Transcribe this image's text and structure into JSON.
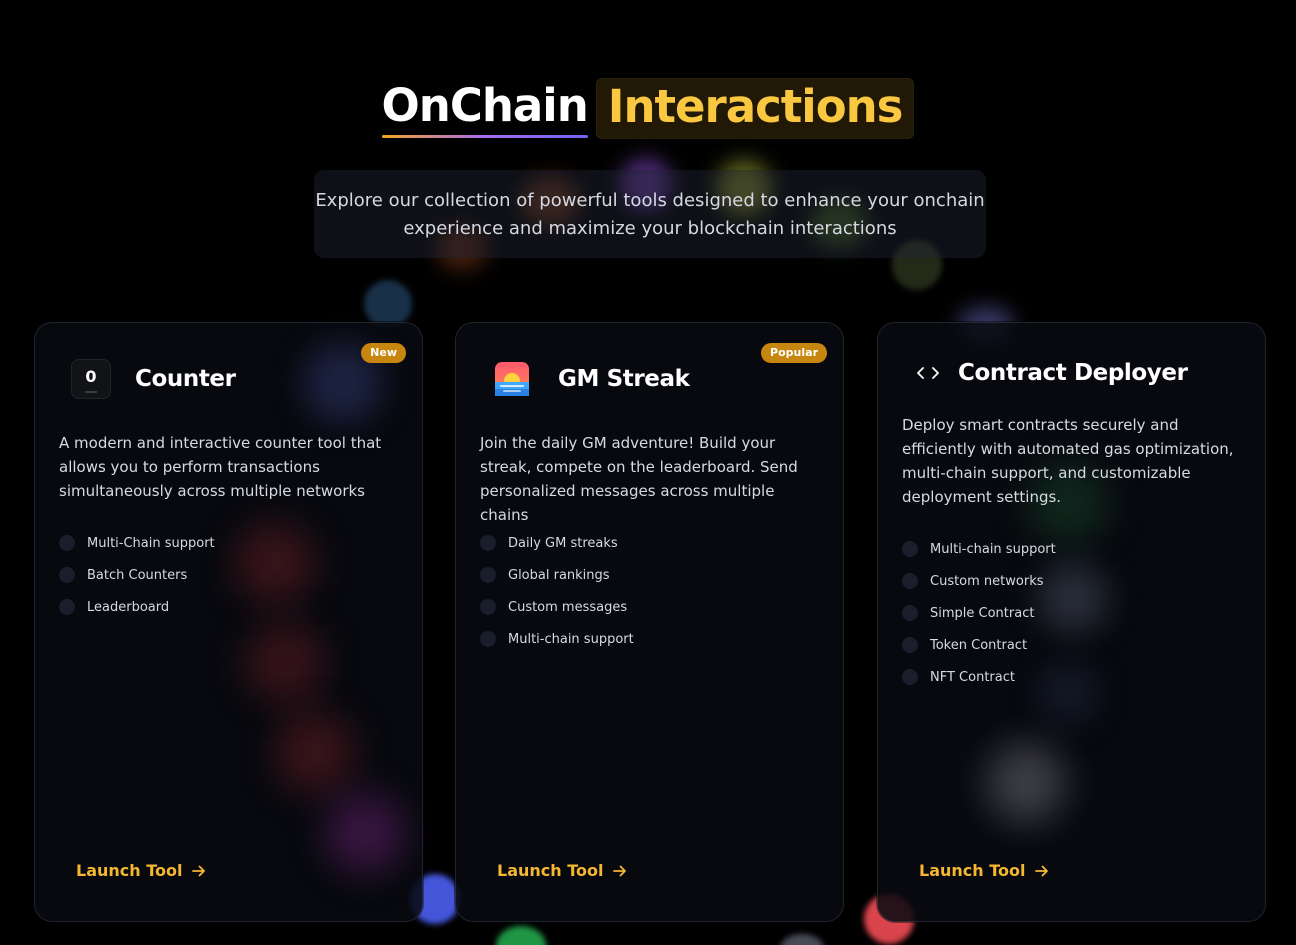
{
  "header": {
    "title_part1": "OnChain",
    "title_part2": "Interactions",
    "subtitle": "Explore our collection of powerful tools designed to enhance your onchain experience and maximize your blockchain interactions"
  },
  "colors": {
    "accent": "#f9c740",
    "badge": "#c7860f",
    "launch": "#f5b730",
    "background": "#000000"
  },
  "cards": [
    {
      "badge": "New",
      "icon": "counter-icon",
      "icon_digit": "0",
      "title": "Counter",
      "description": "A modern and interactive counter tool that allows you to perform transactions simultaneously across multiple networks",
      "features": [
        "Multi-Chain support",
        "Batch Counters",
        "Leaderboard"
      ],
      "cta": "Launch Tool"
    },
    {
      "badge": "Popular",
      "icon": "sunrise-icon",
      "title": "GM Streak",
      "description": "Join the daily GM adventure! Build your streak, compete on the leaderboard. Send personalized messages across multiple chains",
      "features": [
        "Daily GM streaks",
        "Global rankings",
        "Custom messages",
        "Multi-chain support"
      ],
      "cta": "Launch Tool"
    },
    {
      "icon": "code-icon",
      "title": "Contract Deployer",
      "description": "Deploy smart contracts securely and efficiently with automated gas optimization, multi-chain support, and customizable deployment settings.",
      "features": [
        "Multi-chain support",
        "Custom networks",
        "Simple Contract",
        "Token Contract",
        "NFT Contract"
      ],
      "cta": "Launch Tool"
    }
  ]
}
